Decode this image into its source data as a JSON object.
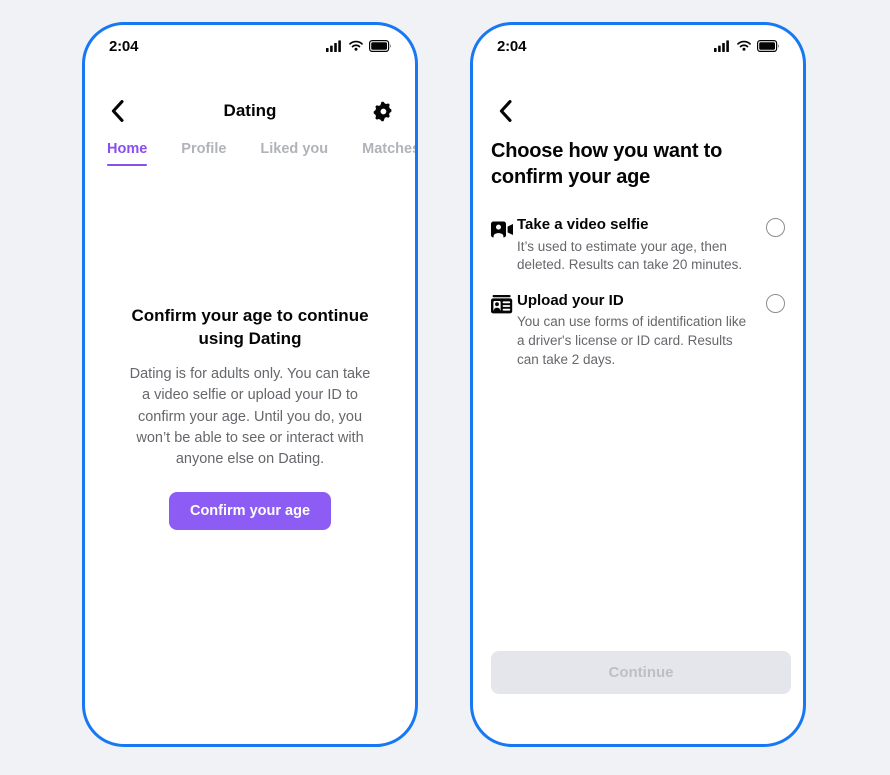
{
  "theme": {
    "page_bg": "#f0f2f5",
    "phone_border": "#1877f2",
    "accent_purple": "#8a4df0",
    "button_purple": "#8c5cf5",
    "text_primary": "#050505",
    "text_secondary": "#65676b",
    "text_muted": "#b0b3b8",
    "disabled_bg": "#e4e6eb",
    "disabled_text": "#bcc0c4"
  },
  "screen_one": {
    "status_bar": {
      "time": "2:04",
      "icons": [
        "cellular-signal-icon",
        "wifi-icon",
        "battery-icon"
      ]
    },
    "nav": {
      "back_icon": "chevron-left-icon",
      "title": "Dating",
      "settings_icon": "gear-icon"
    },
    "tabs": [
      {
        "label": "Home",
        "active": true
      },
      {
        "label": "Profile",
        "active": false
      },
      {
        "label": "Liked you",
        "active": false
      },
      {
        "label": "Matches",
        "active": false
      }
    ],
    "content": {
      "heading": "Confirm your age to continue using Dating",
      "body": "Dating is for adults only. You can take a video selfie or upload your ID to confirm your age. Until you do, you won’t be able to see or interact with anyone else on Dating.",
      "cta_label": "Confirm your age"
    }
  },
  "screen_two": {
    "status_bar": {
      "time": "2:04",
      "icons": [
        "cellular-signal-icon",
        "wifi-icon",
        "battery-icon"
      ]
    },
    "nav": {
      "back_icon": "chevron-left-icon"
    },
    "title": "Choose how you want to confirm your age",
    "options": [
      {
        "icon": "video-selfie-icon",
        "title": "Take a video selfie",
        "description": "It’s used to estimate your age, then deleted. Results can take 20 minutes.",
        "selected": false
      },
      {
        "icon": "id-card-icon",
        "title": "Upload your ID",
        "description": "You can use forms of identification like a driver's license or ID card. Results can take 2 days.",
        "selected": false
      }
    ],
    "continue_label": "Continue",
    "continue_enabled": false
  }
}
